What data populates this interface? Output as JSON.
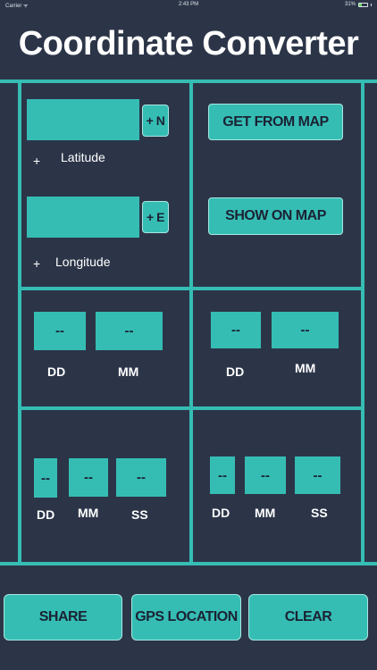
{
  "status_bar": {
    "carrier": "Carrier ᯤ",
    "time": "2:43 PM",
    "battery": "31%",
    "battery_level": 0.31
  },
  "title": "Coordinate Converter",
  "latitude": {
    "value": "",
    "hemisphere_button": "+ N",
    "sign": "+",
    "label": "Latitude"
  },
  "longitude": {
    "value": "",
    "hemisphere_button": "+ E",
    "sign": "+",
    "label": "Longitude"
  },
  "get_from_map_label": "GET FROM  MAP",
  "show_on_map_label": "SHOW ON MAP",
  "ddm_lat": {
    "dd": "--",
    "mm": "--",
    "dd_label": "DD",
    "mm_label": "MM"
  },
  "ddm_lon": {
    "dd": "--",
    "mm": "--",
    "dd_label": "DD",
    "mm_label": "MM"
  },
  "dms_lat": {
    "dd": "--",
    "mm": "--",
    "ss": "--",
    "dd_label": "DD",
    "mm_label": "MM",
    "ss_label": "SS"
  },
  "dms_lon": {
    "dd": "--",
    "mm": "--",
    "ss": "--",
    "dd_label": "DD",
    "mm_label": "MM",
    "ss_label": "SS"
  },
  "bottom": {
    "share": "SHARE",
    "gps": "GPS LOCATION",
    "clear": "CLEAR"
  },
  "colors": {
    "background": "#2c3548",
    "accent": "#35bdb4"
  }
}
